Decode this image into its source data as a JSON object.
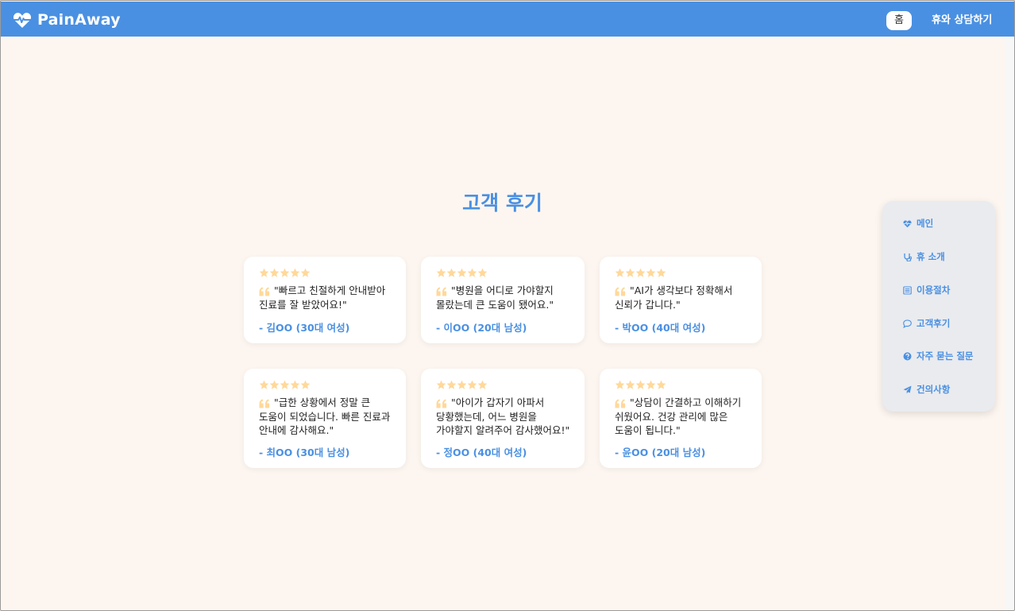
{
  "app": {
    "brand": "PainAway",
    "accent_color": "#4a90e2",
    "background_color": "#fdf6f0"
  },
  "nav": {
    "home_label": "홈",
    "consult_label": "휴와 상담하기"
  },
  "reviews": {
    "title": "고객 후기",
    "star_color": "#ffd89a",
    "items": [
      {
        "rating": 5,
        "text": "\"빠르고 친절하게 안내받아 진료를 잘 받았어요!\"",
        "author": "- 김OO (30대 여성)"
      },
      {
        "rating": 5,
        "text": "\"병원을 어디로 가야할지 몰랐는데 큰 도움이 됐어요.\"",
        "author": "- 이OO (20대 남성)"
      },
      {
        "rating": 5,
        "text": "\"AI가 생각보다 정확해서 신뢰가 갑니다.\"",
        "author": "- 박OO (40대 여성)"
      },
      {
        "rating": 5,
        "text": "\"급한 상황에서 정말 큰 도움이 되었습니다. 빠른 진료과 안내에 감사해요.\"",
        "author": "- 최OO (30대 남성)"
      },
      {
        "rating": 5,
        "text": "\"아이가 갑자기 아파서 당황했는데, 어느 병원을 가야할지 알려주어 감사했어요!\"",
        "author": "- 정OO (40대 여성)"
      },
      {
        "rating": 5,
        "text": "\"상담이 간결하고 이해하기 쉬웠어요. 건강 관리에 많은 도움이 됩니다.\"",
        "author": "- 윤OO (20대 남성)"
      }
    ]
  },
  "side_menu": {
    "items": [
      {
        "label": "메인",
        "icon": "heart-pulse-icon"
      },
      {
        "label": "휴 소개",
        "icon": "stethoscope-icon"
      },
      {
        "label": "이용절차",
        "icon": "list-icon"
      },
      {
        "label": "고객후기",
        "icon": "chat-bubble-icon"
      },
      {
        "label": "자주 묻는 질문",
        "icon": "question-circle-icon"
      },
      {
        "label": "건의사항",
        "icon": "paper-plane-icon"
      }
    ]
  }
}
